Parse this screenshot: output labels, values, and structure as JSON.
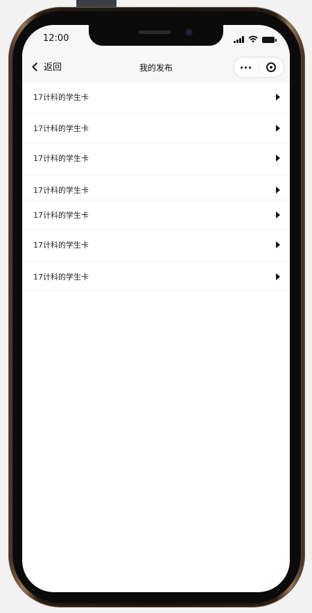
{
  "status_bar": {
    "time": "12:00"
  },
  "nav": {
    "back_label": "返回",
    "title": "我的发布"
  },
  "items": [
    {
      "label": "17计科的学生卡"
    },
    {
      "label": "17计科的学生卡"
    },
    {
      "label": "17计科的学生卡"
    },
    {
      "label": "17计科的学生卡"
    },
    {
      "label": "17计科的学生卡"
    },
    {
      "label": "17计科的学生卡"
    },
    {
      "label": "17计科的学生卡"
    }
  ],
  "icons": {
    "back": "chevron-left-icon",
    "more": "more-dots-icon",
    "close": "target-icon",
    "arrow": "arrow-right-icon"
  }
}
